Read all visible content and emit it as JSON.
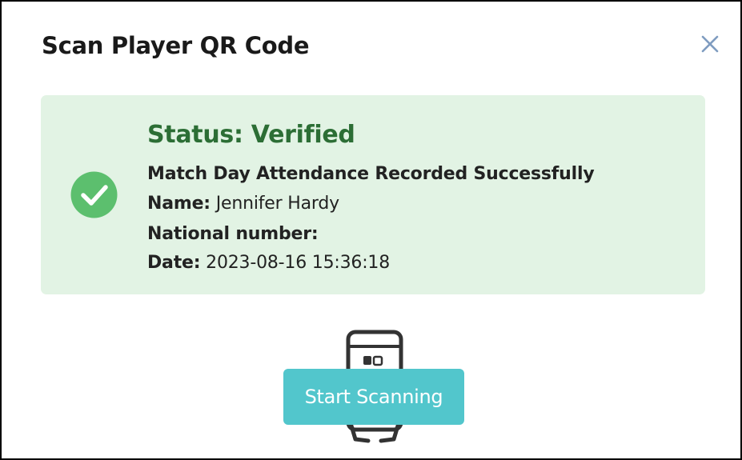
{
  "dialog": {
    "title": "Scan Player QR Code",
    "close_icon": "close-icon"
  },
  "status": {
    "icon": "check-circle-icon",
    "title": "Status: Verified",
    "message": "Match Day Attendance Recorded Successfully",
    "name_label": "Name:",
    "name_value": "Jennifer Hardy",
    "national_number_label": "National number:",
    "national_number_value": "",
    "date_label": "Date:",
    "date_value": "2023-08-16 15:36:18"
  },
  "scanner": {
    "illustration_icon": "phone-scan-icon",
    "button_label": "Start Scanning"
  },
  "colors": {
    "status_background": "#e2f3e4",
    "status_title": "#2c6e35",
    "check_circle": "#5cbf6e",
    "button": "#52c6cc",
    "close_icon": "#7f9cc0"
  }
}
